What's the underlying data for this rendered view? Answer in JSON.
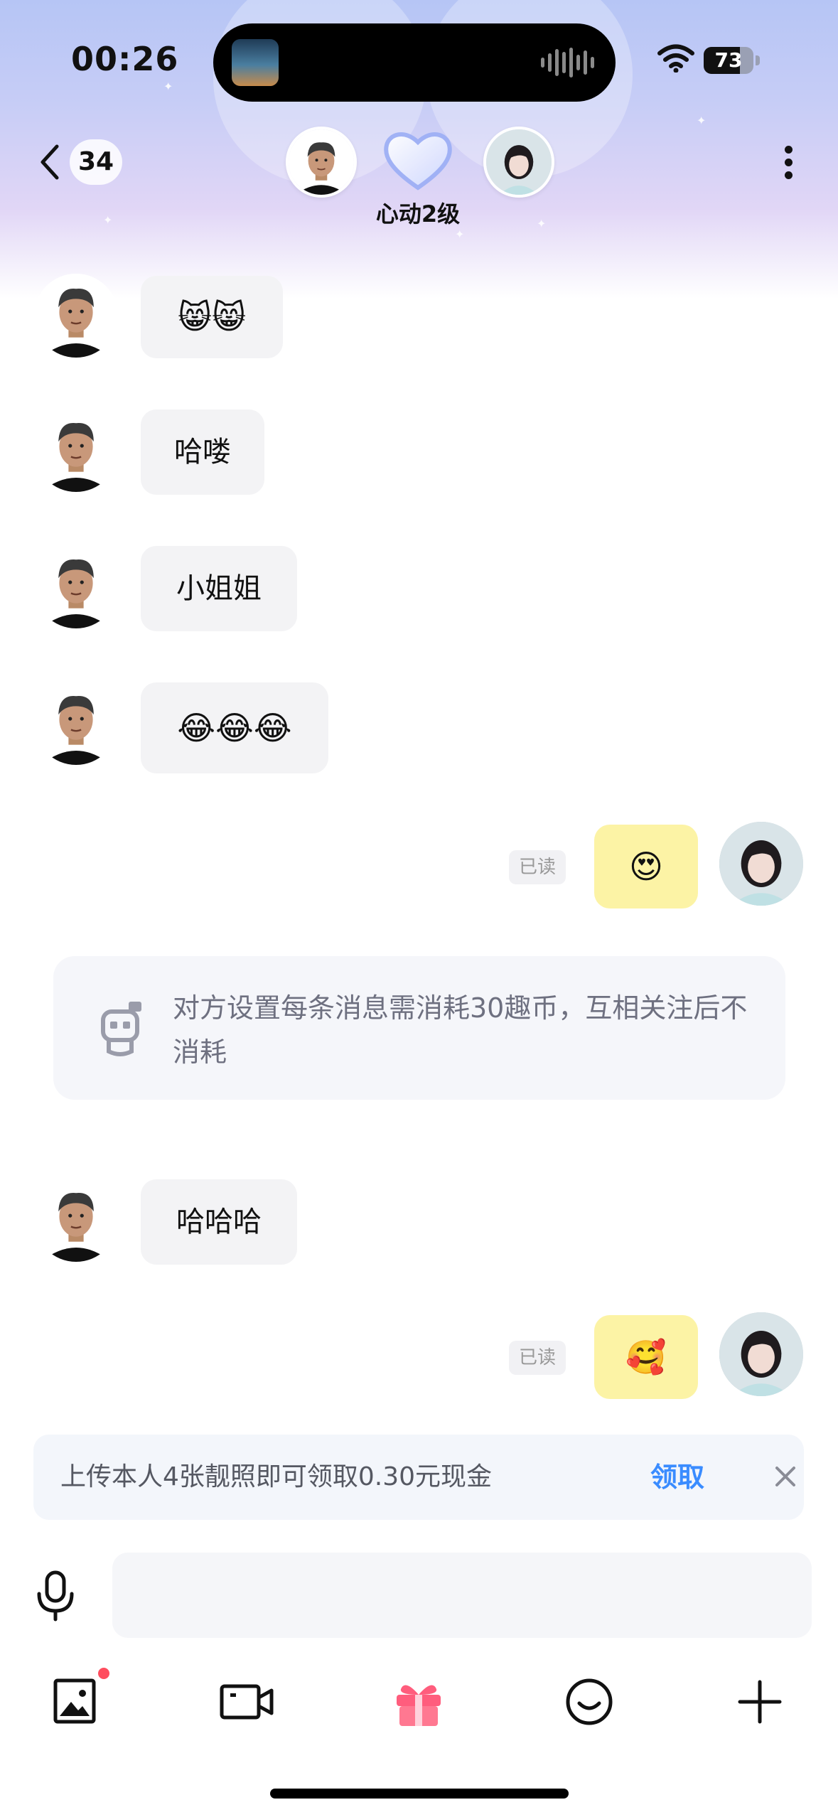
{
  "status_bar": {
    "time": "00:26",
    "battery": "73"
  },
  "header": {
    "unread_count": "34",
    "intimacy_level": "心动2级"
  },
  "messages": [
    {
      "from": "them",
      "text": "😸😸"
    },
    {
      "from": "them",
      "text": "哈喽"
    },
    {
      "from": "them",
      "text": "小姐姐"
    },
    {
      "from": "them",
      "text": "😂😂😂"
    },
    {
      "from": "me",
      "text": "😍",
      "status": "已读"
    },
    {
      "from": "them",
      "text": "哈哈哈"
    },
    {
      "from": "me",
      "text": "🥰",
      "status": "已读"
    }
  ],
  "system_notice": "对方设置每条消息需消耗30趣币，互相关注后不消耗",
  "promo": {
    "text": "上传本人4张靓照即可领取0.30元现金",
    "claim_label": "领取"
  },
  "input": {
    "value": ""
  },
  "toolbar": {
    "items": [
      "image-icon",
      "video-icon",
      "gift-icon",
      "emoji-icon",
      "plus-icon"
    ]
  },
  "colors": {
    "accent": "#3a8cff",
    "my_bubble": "#fcf3a5",
    "their_bubble": "#f3f3f5",
    "notify_dot": "#ff4d5e"
  }
}
